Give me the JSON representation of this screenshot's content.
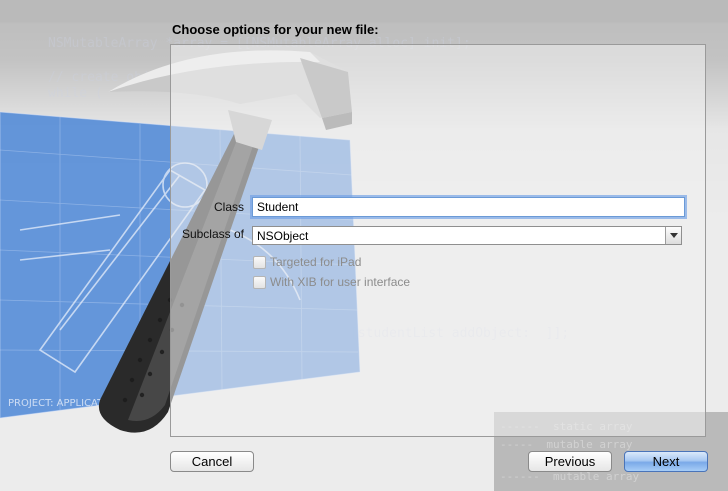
{
  "dialog": {
    "title": "Choose options for your new file:",
    "class_label": "Class",
    "class_value": "Student",
    "subclass_label": "Subclass of",
    "subclass_value": "NSObject",
    "targeted_ipad_label": "Targeted for iPad",
    "with_xib_label": "With XIB for user interface"
  },
  "buttons": {
    "cancel": "Cancel",
    "previous": "Previous",
    "next": "Next"
  },
  "colors": {
    "accent": "#7aa9e8",
    "focus_ring": "#6b9ad6",
    "disabled_text": "#8c8c8c",
    "blueprint": "#3f7fd6"
  },
  "icons": {
    "xcode_artwork": "hammer-on-blueprint-icon",
    "dropdown": "chevron-down-icon"
  }
}
